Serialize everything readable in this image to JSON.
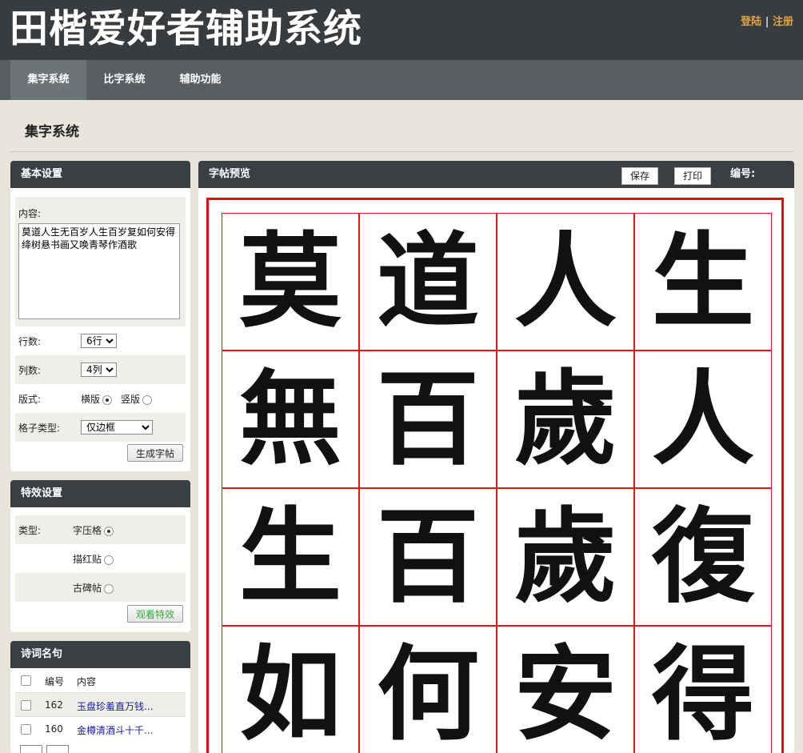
{
  "header": {
    "title": "田楷爱好者辅助系统",
    "login": "登陆",
    "separator": "|",
    "register": "注册"
  },
  "nav": [
    {
      "label": "集字系统",
      "active": true
    },
    {
      "label": "比字系统",
      "active": false
    },
    {
      "label": "辅助功能",
      "active": false
    }
  ],
  "page_title": "集字系统",
  "basic": {
    "title": "基本设置",
    "content_label": "内容:",
    "content_value": "莫道人生无百岁人生百岁复如何安得绛树悬书画又唤青琴作酒歌",
    "rows_label": "行数:",
    "rows_value": "6行",
    "cols_label": "列数:",
    "cols_value": "4列",
    "layout_label": "版式:",
    "layout_horizontal": "横版",
    "layout_vertical": "竖版",
    "grid_label": "格子类型:",
    "grid_value": "仅边框",
    "generate_button": "生成字帖"
  },
  "effects": {
    "title": "特效设置",
    "type_label": "类型:",
    "options": [
      {
        "label": "字压格",
        "checked": true
      },
      {
        "label": "描红贴",
        "checked": false
      },
      {
        "label": "古碑帖",
        "checked": false
      }
    ],
    "view_button": "观看特效"
  },
  "poems": {
    "title": "诗词名句",
    "col_id": "编号",
    "col_content": "内容",
    "rows": [
      {
        "id": "162",
        "content": "玉盘珍羞直万钱..."
      },
      {
        "id": "160",
        "content": "金樽清酒斗十千..."
      }
    ]
  },
  "preview": {
    "title": "字帖预览",
    "save_button": "保存",
    "print_button": "打印",
    "number_label": "编号:",
    "characters": [
      "莫",
      "道",
      "人",
      "生",
      "無",
      "百",
      "歲",
      "人",
      "生",
      "百",
      "歲",
      "復",
      "如",
      "何",
      "安",
      "得"
    ]
  }
}
